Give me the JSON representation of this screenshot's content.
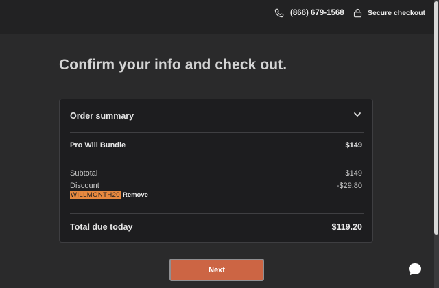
{
  "header": {
    "phone": "(866) 679-1568",
    "secure_label": "Secure checkout"
  },
  "page": {
    "title": "Confirm your info and check out."
  },
  "order_summary": {
    "title": "Order summary",
    "item_name": "Pro Will Bundle",
    "item_price": "$149",
    "subtotal_label": "Subtotal",
    "subtotal_value": "$149",
    "discount_label": "Discount",
    "discount_value": "-$29.80",
    "coupon_code": "WILLMONTH20",
    "remove_label": "Remove",
    "total_label": "Total due today",
    "total_value": "$119.20"
  },
  "actions": {
    "next_label": "Next"
  },
  "colors": {
    "accent": "#cc6544",
    "coupon_highlight": "#e8893f",
    "background": "#2a2a2b",
    "card": "#1d1d1f"
  },
  "icons": {
    "phone": "phone-icon",
    "lock": "lock-icon",
    "chevron": "chevron-down-icon",
    "chat": "chat-bubble-icon"
  }
}
